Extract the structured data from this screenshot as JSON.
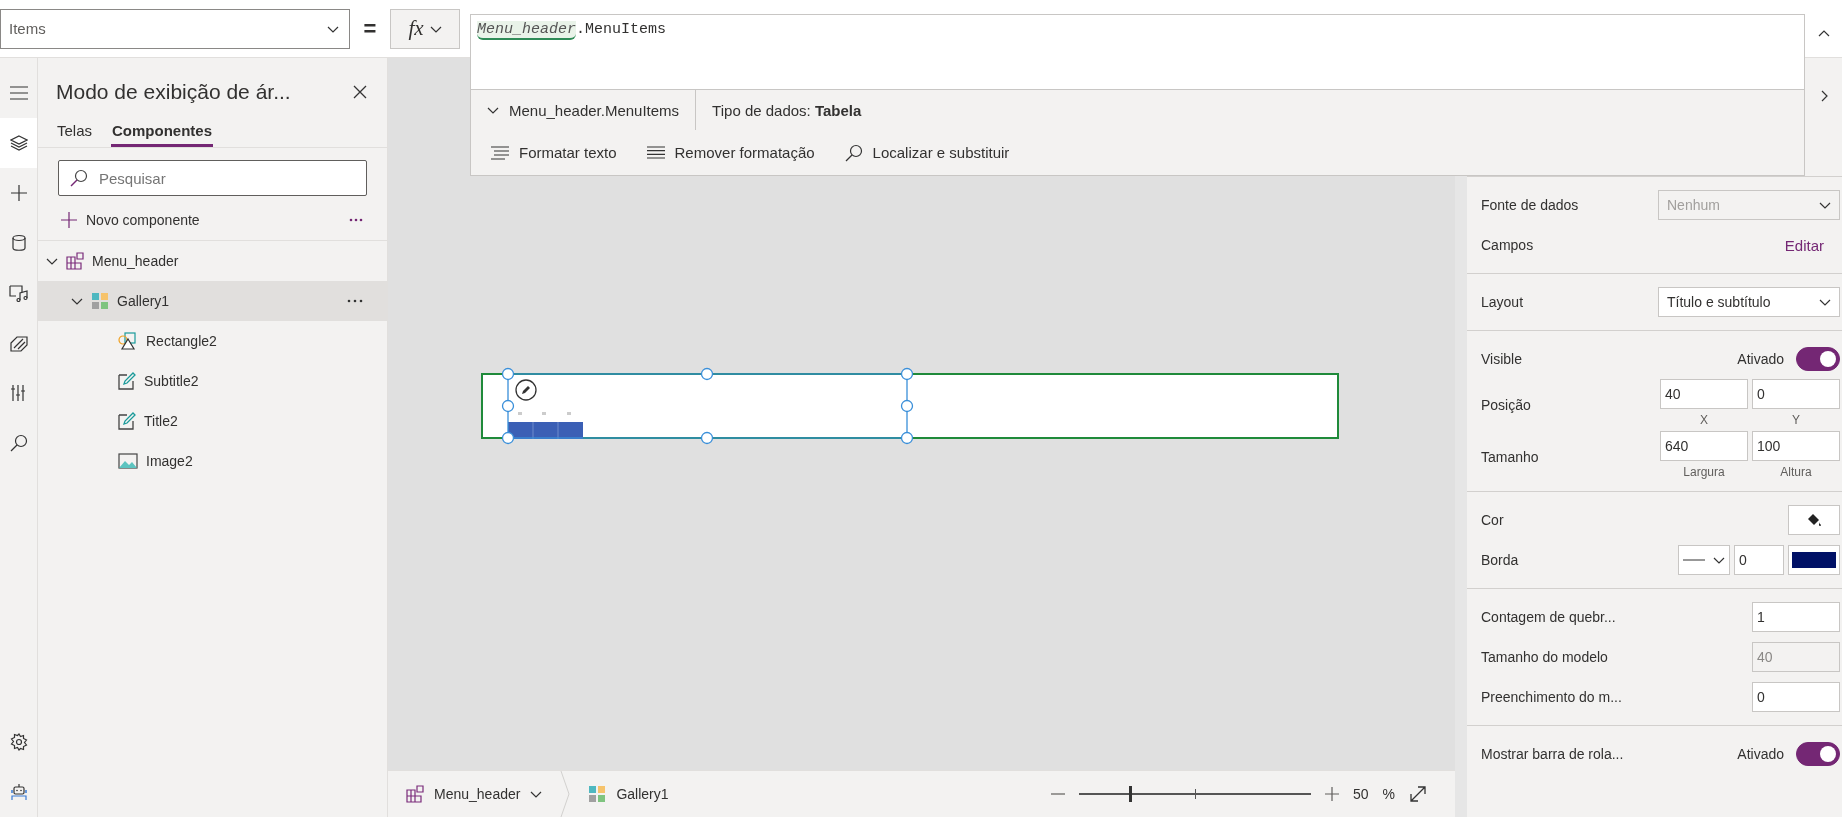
{
  "property_selector": {
    "value": "Items"
  },
  "equals": "=",
  "fx_button": {
    "label": "fx"
  },
  "formula": {
    "tokens": [
      {
        "text": "Menu_header",
        "kind": "reference"
      },
      {
        "text": ".MenuItems",
        "kind": "plain"
      }
    ]
  },
  "formula_info": {
    "expression": "Menu_header.MenuItems",
    "type_label": "Tipo de dados:",
    "type_value": "Tabela"
  },
  "formula_tools": [
    {
      "label": "Formatar texto",
      "kind": "format"
    },
    {
      "label": "Remover formatação",
      "kind": "clear"
    },
    {
      "label": "Localizar e substituir",
      "kind": "find"
    }
  ],
  "rail": [
    {
      "kind": "menu",
      "selected": false
    },
    {
      "kind": "layers",
      "selected": true
    },
    {
      "kind": "insert",
      "selected": false
    },
    {
      "kind": "data",
      "selected": false
    },
    {
      "kind": "media",
      "selected": false
    },
    {
      "kind": "variables",
      "selected": false
    },
    {
      "kind": "tools",
      "selected": false
    },
    {
      "kind": "search",
      "selected": false
    },
    {
      "kind": "settings",
      "selected": false
    },
    {
      "kind": "bot",
      "selected": false
    }
  ],
  "left_panel": {
    "title": "Modo de exibição de ár...",
    "tabs": [
      {
        "label": "Telas",
        "selected": false
      },
      {
        "label": "Componentes",
        "selected": true
      }
    ],
    "search": {
      "placeholder": "Pesquisar"
    },
    "new_component": "Novo componente",
    "tree": [
      {
        "label": "Menu_header",
        "kind": "component",
        "expanded": true,
        "selected": false,
        "children": [
          {
            "label": "Gallery1",
            "kind": "gallery",
            "expanded": true,
            "selected": true,
            "children": [
              {
                "label": "Rectangle2",
                "kind": "shape",
                "selected": false
              },
              {
                "label": "Subtitle2",
                "kind": "text",
                "selected": false
              },
              {
                "label": "Title2",
                "kind": "text",
                "selected": false
              },
              {
                "label": "Image2",
                "kind": "image",
                "selected": false
              }
            ]
          }
        ]
      }
    ]
  },
  "breadcrumb": [
    {
      "label": "Menu_header",
      "kind": "component"
    },
    {
      "label": "Gallery1",
      "kind": "gallery"
    }
  ],
  "zoom": {
    "level": 0.22,
    "value": "50",
    "unit": "%"
  },
  "properties": [
    [
      {
        "kind": "dropdown",
        "label": "Fonte de dados",
        "value": "Nenhum",
        "disabled": true
      },
      {
        "kind": "link",
        "label": "Campos",
        "link": "Editar"
      }
    ],
    [
      {
        "kind": "dropdown",
        "label": "Layout",
        "value": "Título e subtítulo",
        "disabled": false
      }
    ],
    [
      {
        "kind": "toggle",
        "label": "Visible",
        "state_label": "Ativado",
        "on": true
      },
      {
        "kind": "pair",
        "label": "Posição",
        "fields": [
          {
            "value": "40",
            "caption": "X"
          },
          {
            "value": "0",
            "caption": "Y"
          }
        ]
      },
      {
        "kind": "pair",
        "label": "Tamanho",
        "fields": [
          {
            "value": "640",
            "caption": "Largura"
          },
          {
            "value": "100",
            "caption": "Altura"
          }
        ]
      }
    ],
    [
      {
        "kind": "fill",
        "label": "Cor"
      },
      {
        "kind": "border",
        "label": "Borda",
        "value": "0",
        "color": "#001166"
      }
    ],
    [
      {
        "kind": "number",
        "label": "Contagem de quebr...",
        "value": "1",
        "disabled": false
      },
      {
        "kind": "number",
        "label": "Tamanho do modelo",
        "value": "40",
        "disabled": true
      },
      {
        "kind": "number",
        "label": "Preenchimento do m...",
        "value": "0",
        "disabled": false
      }
    ],
    [
      {
        "kind": "toggle",
        "label": "Mostrar barra de rola...",
        "state_label": "Ativado",
        "on": true
      }
    ]
  ]
}
